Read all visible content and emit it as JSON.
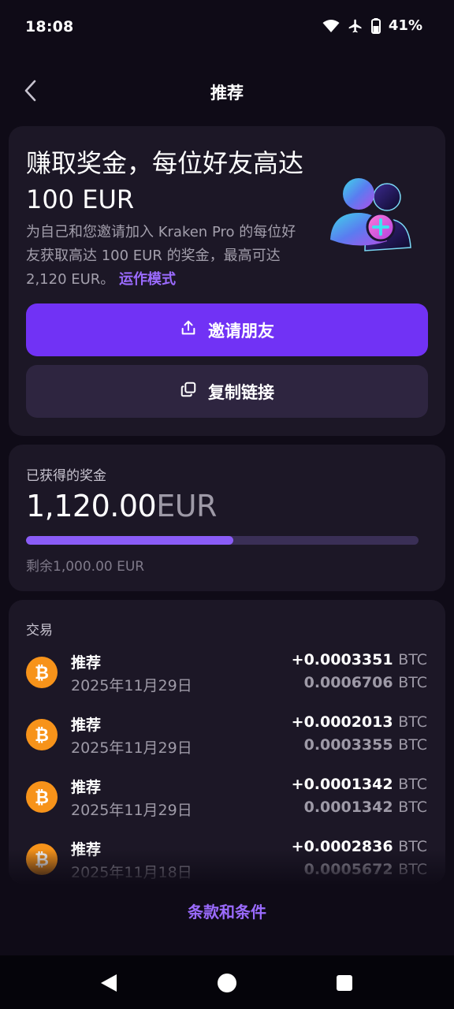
{
  "status_bar": {
    "time": "18:08",
    "battery": "41%",
    "icons": [
      "wifi-icon",
      "airplane-icon",
      "battery-icon"
    ]
  },
  "header": {
    "title": "推荐",
    "back_icon": "chevron-left-icon"
  },
  "referral": {
    "headline": "赚取奖金，每位好友高达 100 EUR",
    "description": "为自己和您邀请加入 Kraken Pro 的每位好友获取高达 100 EUR 的奖金，最高可达 2,120 EUR。",
    "how_it_works_link": "运作模式",
    "illustration": "add-friend-illustration",
    "invite_button": {
      "label": "邀请朋友",
      "icon": "share-upload-icon"
    },
    "copy_button": {
      "label": "复制链接",
      "icon": "copy-icon"
    }
  },
  "earned": {
    "label": "已获得的奖金",
    "amount": "1,120.00",
    "currency": "EUR",
    "progress_fraction": 0.528,
    "remaining": "剩余1,000.00 EUR"
  },
  "transactions": {
    "title": "交易",
    "items": [
      {
        "name": "推荐",
        "date": "2025年11月29日",
        "amount": "+0.0003351",
        "amount_unit": "BTC",
        "total": "0.0006706",
        "total_unit": "BTC",
        "icon": "bitcoin-icon"
      },
      {
        "name": "推荐",
        "date": "2025年11月29日",
        "amount": "+0.0002013",
        "amount_unit": "BTC",
        "total": "0.0003355",
        "total_unit": "BTC",
        "icon": "bitcoin-icon"
      },
      {
        "name": "推荐",
        "date": "2025年11月29日",
        "amount": "+0.0001342",
        "amount_unit": "BTC",
        "total": "0.0001342",
        "total_unit": "BTC",
        "icon": "bitcoin-icon"
      },
      {
        "name": "推荐",
        "date": "2025年11月18日",
        "amount": "+0.0002836",
        "amount_unit": "BTC",
        "total": "0.0005672",
        "total_unit": "BTC",
        "icon": "bitcoin-icon"
      }
    ]
  },
  "footer": {
    "terms_link": "条款和条件"
  },
  "colors": {
    "background": "#0f0b17",
    "card": "#1c1726",
    "accent": "#7132f5",
    "link": "#9b6bff",
    "bitcoin": "#f7931a"
  }
}
